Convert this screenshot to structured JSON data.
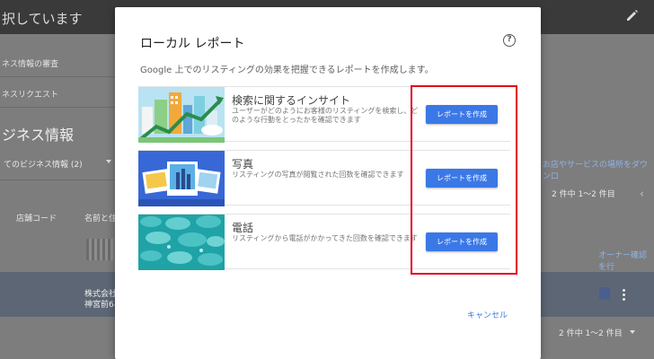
{
  "background": {
    "header_title": "択しています",
    "sidebar_items": [
      "ネス情報の審査",
      "ネスリクエスト"
    ],
    "section_title": "ジネス情報",
    "filter_label": "てのビジネス情報 (2)",
    "columns": [
      "店舗コード",
      "名前と住"
    ],
    "row_cells": [
      "株式会社",
      "神宮前6-"
    ],
    "right_link": "お店やサービスの場所をダウンロ",
    "pagination_top": "2 件中 1〜2 件目",
    "owner_link": "オーナー確認を行",
    "pagination_bottom": "2 件中 1〜2 件目"
  },
  "dialog": {
    "title": "ローカル レポート",
    "description": "Google 上でのリスティングの効果を把握できるレポートを作成します。",
    "cards": [
      {
        "title": "検索に関するインサイト",
        "description": "ユーザーがどのようにお客様のリスティングを検索し、どのような行動をとったかを確認できます",
        "button": "レポートを作成",
        "icon": "insight-chart-illustration"
      },
      {
        "title": "写真",
        "description": "リスティングの写真が閲覧された回数を確認できます",
        "button": "レポートを作成",
        "icon": "photos-illustration"
      },
      {
        "title": "電話",
        "description": "リスティングから電話がかかってきた回数を確認できます",
        "button": "レポートを作成",
        "icon": "calls-illustration"
      }
    ],
    "cancel_label": "キャンセル"
  },
  "colors": {
    "accent_blue": "#3b78e7",
    "highlight_red": "#e2001a"
  }
}
